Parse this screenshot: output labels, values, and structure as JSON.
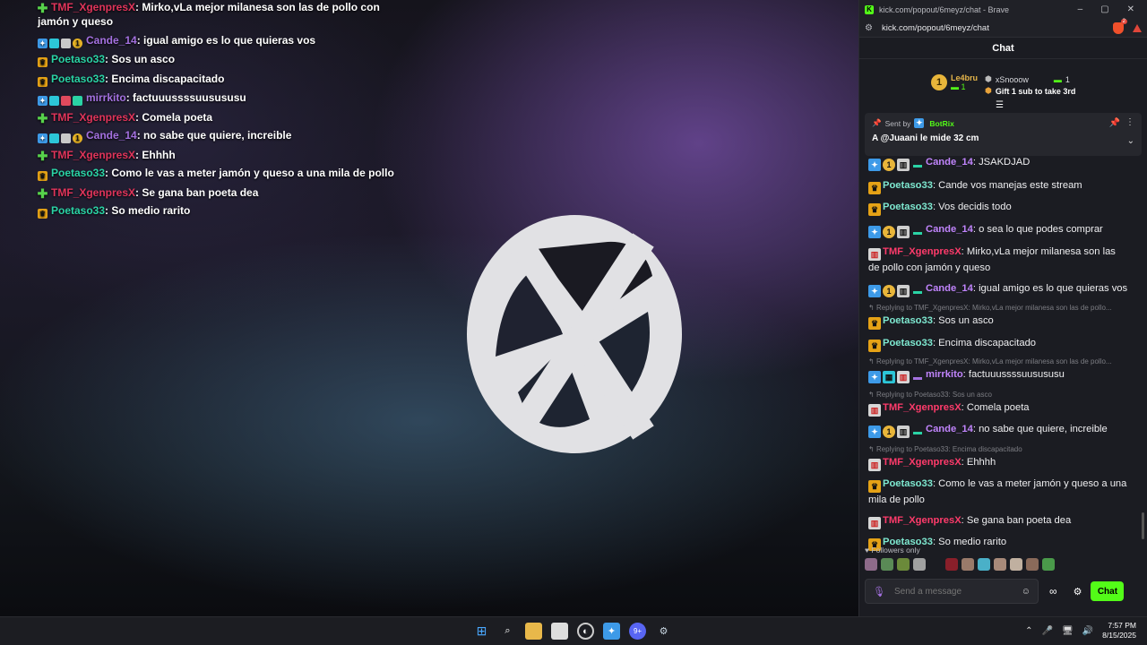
{
  "overlay": {
    "messages": [
      {
        "user": "TMF_XgenpresX",
        "color": "#e0345a",
        "badge": "plus",
        "text": ": Mirko,vLa mejor milanesa son las de pollo con jamón y queso"
      },
      {
        "user": "Cande_14",
        "color": "#a471e0",
        "badge": "multi",
        "text": ": igual amigo es lo que quieras vos"
      },
      {
        "user": "Poetaso33",
        "color": "#2ad3a5",
        "badge": "crown",
        "text": ": Sos un asco"
      },
      {
        "user": "Poetaso33",
        "color": "#2ad3a5",
        "badge": "crown",
        "text": ": Encima discapacitado"
      },
      {
        "user": "mirrkito",
        "color": "#a471e0",
        "badge": "multi2",
        "text": ": factuuussssuusususu"
      },
      {
        "user": "TMF_XgenpresX",
        "color": "#e0345a",
        "badge": "plus",
        "text": ": Comela poeta"
      },
      {
        "user": "Cande_14",
        "color": "#a471e0",
        "badge": "multi",
        "text": ": no sabe que quiere, increible"
      },
      {
        "user": "TMF_XgenpresX",
        "color": "#e0345a",
        "badge": "plus",
        "text": ": Ehhhh"
      },
      {
        "user": "Poetaso33",
        "color": "#2ad3a5",
        "badge": "crown",
        "text": ": Como le vas a meter jamón y queso a una mila de pollo"
      },
      {
        "user": "TMF_XgenpresX",
        "color": "#e0345a",
        "badge": "plus",
        "text": ": Se gana ban poeta dea"
      },
      {
        "user": "Poetaso33",
        "color": "#2ad3a5",
        "badge": "crown",
        "text": ": So medio rarito"
      }
    ]
  },
  "browser": {
    "title": "kick.com/popout/6meyz/chat - Brave",
    "url": "kick.com/popout/6meyz/chat",
    "brave_badge": "2",
    "window_controls": [
      "–",
      "▢",
      "✕"
    ]
  },
  "chat": {
    "header": "Chat",
    "leaderboard": {
      "first_rank": "1",
      "first_name": "Le4bru",
      "first_count": "1",
      "second_name": "xSnooow",
      "second_count": "1",
      "gift_text": "Gift 1 sub to take 3rd"
    },
    "pinned": {
      "sent_by": "Sent by",
      "bot": "BotRix",
      "message": "A @Juaani le mide 32 cm"
    },
    "messages": [
      {
        "reply": "",
        "badges": [
          "blue",
          "gold",
          "gray",
          "teal"
        ],
        "user": "Cande_14",
        "color": "#c084fc",
        "text": ": JSAKDJAD"
      },
      {
        "reply": "",
        "badges": [
          "crown"
        ],
        "user": "Poetaso33",
        "color": "#7ee8d0",
        "text": ": Cande vos manejas este stream"
      },
      {
        "reply": "",
        "badges": [
          "crown"
        ],
        "user": "Poetaso33",
        "color": "#7ee8d0",
        "text": ": Vos decidis todo"
      },
      {
        "reply": "",
        "badges": [
          "blue",
          "gold",
          "gray",
          "teal"
        ],
        "user": "Cande_14",
        "color": "#c084fc",
        "text": ": o sea lo que podes comprar"
      },
      {
        "reply": "",
        "badges": [
          "red"
        ],
        "user": "TMF_XgenpresX",
        "color": "#ff3b6b",
        "text": ": Mirko,vLa mejor milanesa son las de pollo con jamón y queso"
      },
      {
        "reply": "",
        "badges": [
          "blue",
          "gold",
          "gray",
          "teal"
        ],
        "user": "Cande_14",
        "color": "#c084fc",
        "text": ": igual amigo es lo que quieras vos"
      },
      {
        "reply": "Replying to TMF_XgenpresX: Mirko,vLa mejor milanesa son las de pollo...",
        "badges": [
          "crown"
        ],
        "user": "Poetaso33",
        "color": "#7ee8d0",
        "text": ": Sos un asco"
      },
      {
        "reply": "",
        "badges": [
          "crown"
        ],
        "user": "Poetaso33",
        "color": "#7ee8d0",
        "text": ": Encima discapacitado"
      },
      {
        "reply": "Replying to TMF_XgenpresX: Mirko,vLa mejor milanesa son las de pollo...",
        "badges": [
          "blue",
          "cyan",
          "red",
          "purple"
        ],
        "user": "mirrkito",
        "color": "#c084fc",
        "text": ": factuuussssuusususu"
      },
      {
        "reply": "Replying to Poetaso33: Sos un asco",
        "badges": [
          "red"
        ],
        "user": "TMF_XgenpresX",
        "color": "#ff3b6b",
        "text": ": Comela poeta"
      },
      {
        "reply": "",
        "badges": [
          "blue",
          "gold",
          "gray",
          "teal"
        ],
        "user": "Cande_14",
        "color": "#c084fc",
        "text": ": no sabe que quiere, increible"
      },
      {
        "reply": "Replying to Poetaso33: Encima discapacitado",
        "badges": [
          "red"
        ],
        "user": "TMF_XgenpresX",
        "color": "#ff3b6b",
        "text": ": Ehhhh"
      },
      {
        "reply": "",
        "badges": [
          "crown"
        ],
        "user": "Poetaso33",
        "color": "#7ee8d0",
        "text": ": Como le vas a meter jamón y queso a una mila de pollo"
      },
      {
        "reply": "",
        "badges": [
          "red"
        ],
        "user": "TMF_XgenpresX",
        "color": "#ff3b6b",
        "text": ": Se gana ban poeta dea"
      },
      {
        "reply": "",
        "badges": [
          "crown"
        ],
        "user": "Poetaso33",
        "color": "#7ee8d0",
        "text": ": So medio rarito"
      }
    ],
    "followers_only": "Followers only",
    "input_placeholder": "Send a message",
    "send_label": "Chat",
    "accent": "#53fc18"
  },
  "taskbar": {
    "time": "7:57 PM",
    "date": "8/15/2025",
    "discord_badge": "9+"
  }
}
